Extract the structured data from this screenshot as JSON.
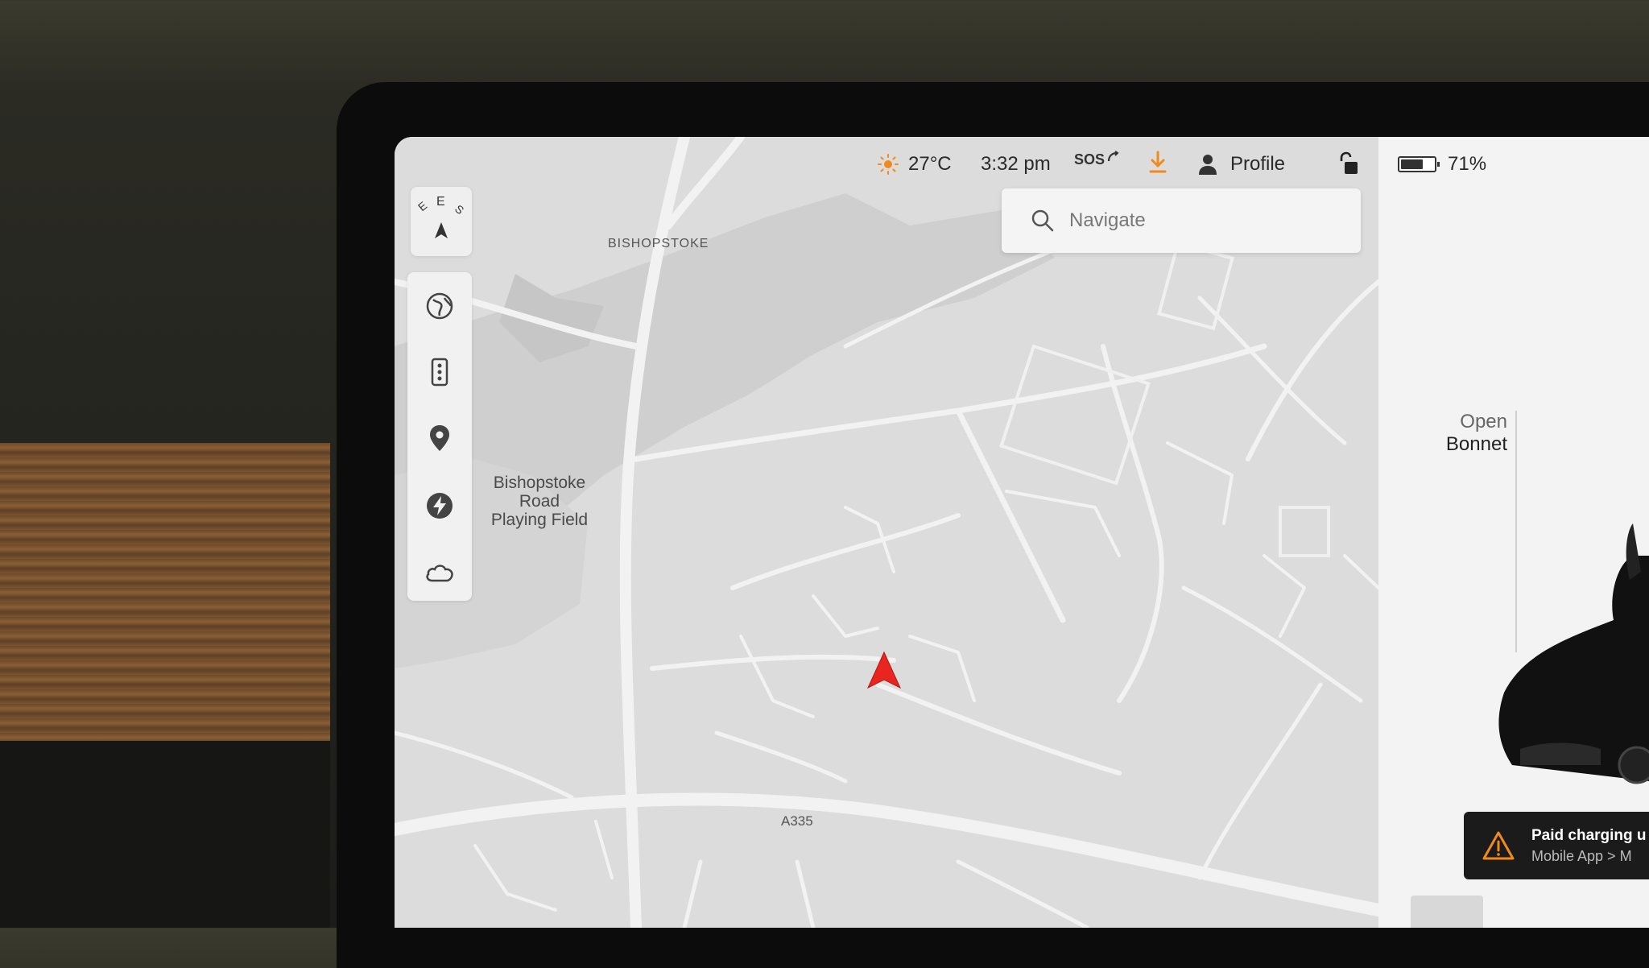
{
  "status": {
    "temperature": "27°C",
    "time": "3:32 pm",
    "sos": "SOS",
    "profile": "Profile",
    "battery": "71%",
    "battery_level": 0.71
  },
  "search": {
    "placeholder": "Navigate"
  },
  "compass": {
    "letters": [
      "E",
      "E",
      "S"
    ]
  },
  "map_labels": {
    "area": "BISHOPSTOKE",
    "park_1": "Bishopstoke",
    "park_2": "Road",
    "park_3": "Playing Field",
    "road": "A335"
  },
  "car": {
    "open_label": "Open",
    "part_label": "Bonnet"
  },
  "alert": {
    "line1": "Paid charging u",
    "line2": "Mobile App > M"
  },
  "colors": {
    "accent_orange": "#f08a1c",
    "nav_red": "#e8261f",
    "map_bg": "#dcdcdc"
  },
  "icons": [
    "sun-icon",
    "sos-icon",
    "download-icon",
    "person-icon",
    "unlock-icon",
    "battery-icon",
    "search-icon",
    "globe-icon",
    "traffic-icon",
    "pin-icon",
    "charge-icon",
    "weather-icon",
    "warning-icon"
  ]
}
